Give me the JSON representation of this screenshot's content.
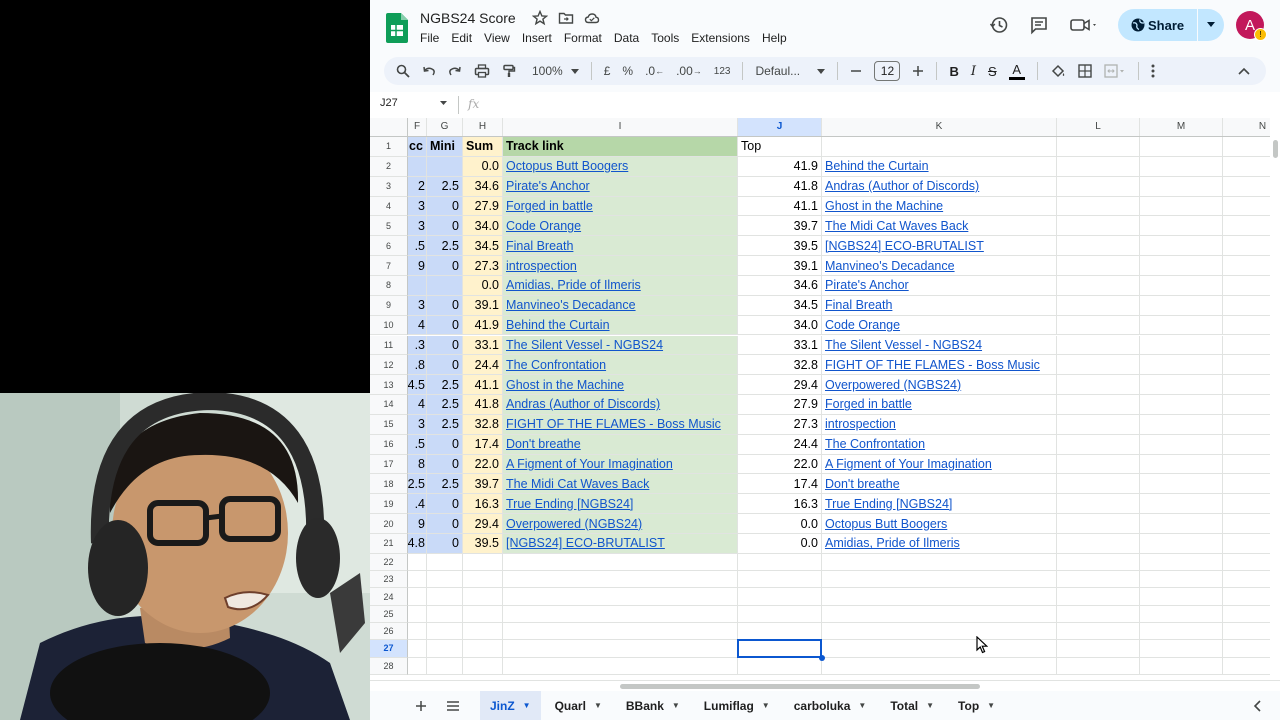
{
  "doc": {
    "title": "NGBS24 Score",
    "menu": [
      "File",
      "Edit",
      "View",
      "Insert",
      "Format",
      "Data",
      "Tools",
      "Extensions",
      "Help"
    ],
    "share_label": "Share",
    "avatar_letter": "A"
  },
  "toolbar": {
    "zoom": "100%",
    "currency": "£",
    "percent": "%",
    "dec_less": ".0",
    "dec_more": ".00",
    "num_format": "123",
    "font": "Defaul...",
    "font_size": "12"
  },
  "formula_bar": {
    "name_box": "J27",
    "fx_label": "fx"
  },
  "grid": {
    "columns": [
      {
        "id": "F",
        "label": "F"
      },
      {
        "id": "G",
        "label": "G"
      },
      {
        "id": "H",
        "label": "H"
      },
      {
        "id": "I",
        "label": "I"
      },
      {
        "id": "J",
        "label": "J"
      },
      {
        "id": "K",
        "label": "K"
      },
      {
        "id": "L",
        "label": "L"
      },
      {
        "id": "M",
        "label": "M"
      },
      {
        "id": "N",
        "label": "N"
      }
    ],
    "row_numbers": [
      "1",
      "2",
      "3",
      "4",
      "5",
      "6",
      "7",
      "8",
      "9",
      "10",
      "11",
      "12",
      "13",
      "14",
      "15",
      "16",
      "17",
      "18",
      "19",
      "20",
      "21",
      "22",
      "23",
      "24",
      "25",
      "26",
      "27",
      "28"
    ],
    "header_row": {
      "F": "cc",
      "G": "Mini",
      "H": "Sum",
      "I": "Track link",
      "J": "Top"
    },
    "rows": [
      {
        "F": "",
        "G": "",
        "H": "0.0",
        "I": "Octopus Butt Boogers",
        "J": "41.9",
        "K": "Behind the Curtain"
      },
      {
        "F": "2",
        "G": "2.5",
        "H": "34.6",
        "I": "Pirate's Anchor",
        "J": "41.8",
        "K": "Andras (Author of Discords)"
      },
      {
        "F": "3",
        "G": "0",
        "H": "27.9",
        "I": "Forged in battle",
        "J": "41.1",
        "K": "Ghost in the Machine"
      },
      {
        "F": "3",
        "G": "0",
        "H": "34.0",
        "I": "Code Orange",
        "J": "39.7",
        "K": "The Midi Cat Waves Back"
      },
      {
        "F": ".5",
        "G": "2.5",
        "H": "34.5",
        "I": "Final Breath",
        "J": "39.5",
        "K": "[NGBS24] ECO-BRUTALIST"
      },
      {
        "F": "9",
        "G": "0",
        "H": "27.3",
        "I": "introspection",
        "J": "39.1",
        "K": "Manvineo's Decadance"
      },
      {
        "F": "",
        "G": "",
        "H": "0.0",
        "I": "Amidias, Pride of Ilmeris",
        "J": "34.6",
        "K": "Pirate's Anchor"
      },
      {
        "F": "3",
        "G": "0",
        "H": "39.1",
        "I": "Manvineo's Decadance",
        "J": "34.5",
        "K": "Final Breath"
      },
      {
        "F": "4",
        "G": "0",
        "H": "41.9",
        "I": "Behind the Curtain",
        "J": "34.0",
        "K": "Code Orange"
      },
      {
        "F": ".3",
        "G": "0",
        "H": "33.1",
        "I": "The Silent Vessel - NGBS24",
        "J": "33.1",
        "K": "The Silent Vessel - NGBS24"
      },
      {
        "F": ".8",
        "G": "0",
        "H": "24.4",
        "I": "The Confrontation",
        "J": "32.8",
        "K": "FIGHT OF THE FLAMES - Boss Music"
      },
      {
        "F": "4.5",
        "G": "2.5",
        "H": "41.1",
        "I": "Ghost in the Machine",
        "J": "29.4",
        "K": "Overpowered (NGBS24)"
      },
      {
        "F": "4",
        "G": "2.5",
        "H": "41.8",
        "I": "Andras (Author of Discords)",
        "J": "27.9",
        "K": "Forged in battle"
      },
      {
        "F": "3",
        "G": "2.5",
        "H": "32.8",
        "I": "FIGHT OF THE FLAMES - Boss Music",
        "J": "27.3",
        "K": "introspection"
      },
      {
        "F": ".5",
        "G": "0",
        "H": "17.4",
        "I": "Don't breathe",
        "J": "24.4",
        "K": "The Confrontation"
      },
      {
        "F": "8",
        "G": "0",
        "H": "22.0",
        "I": "A Figment of Your Imagination",
        "J": "22.0",
        "K": "A Figment of Your Imagination"
      },
      {
        "F": "2.5",
        "G": "2.5",
        "H": "39.7",
        "I": "The Midi Cat Waves Back",
        "J": "17.4",
        "K": "Don't breathe"
      },
      {
        "F": ".4",
        "G": "0",
        "H": "16.3",
        "I": "True Ending [NGBS24]",
        "J": "16.3",
        "K": "True Ending [NGBS24]"
      },
      {
        "F": "9",
        "G": "0",
        "H": "29.4",
        "I": "Overpowered (NGBS24)",
        "J": "0.0",
        "K": "Octopus Butt Boogers"
      },
      {
        "F": "4.8",
        "G": "0",
        "H": "39.5",
        "I": "[NGBS24] ECO-BRUTALIST",
        "J": "0.0",
        "K": "Amidias, Pride of Ilmeris"
      }
    ]
  },
  "sheet_tabs": [
    {
      "label": "JinZ",
      "active": true
    },
    {
      "label": "Quarl",
      "active": false
    },
    {
      "label": "BBank",
      "active": false
    },
    {
      "label": "Lumiflag",
      "active": false
    },
    {
      "label": "carboluka",
      "active": false
    },
    {
      "label": "Total",
      "active": false
    },
    {
      "label": "Top",
      "active": false
    }
  ],
  "colors": {
    "accent": "#0b57d0",
    "share_bg": "#c2e7ff",
    "link": "#1155cc",
    "col_blue": "#c9daf8",
    "col_yellow": "#fff2cc",
    "col_green": "#d9ead3",
    "header_green": "#b6d7a8"
  }
}
